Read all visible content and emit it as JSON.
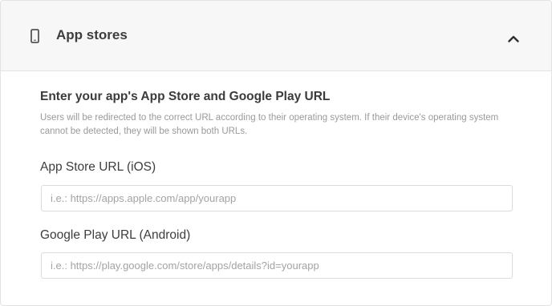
{
  "header": {
    "title": "App stores",
    "icon": "phone-icon",
    "toggle_icon": "chevron-up-icon"
  },
  "section": {
    "title": "Enter your app's App Store and Google Play URL",
    "description": "Users will be redirected to the correct URL according to their operating system. If their device's operating system cannot be detected, they will be shown both URLs."
  },
  "fields": {
    "ios": {
      "label": "App Store URL (iOS)",
      "value": "",
      "placeholder": "i.e.: https://apps.apple.com/app/yourapp"
    },
    "android": {
      "label": "Google Play URL (Android)",
      "value": "",
      "placeholder": "i.e.: https://play.google.com/store/apps/details?id=yourapp"
    }
  },
  "colors": {
    "header_bg": "#f7f7f7",
    "border": "#e3e3e3",
    "title_text": "#3d3d3d",
    "muted_text": "#9a9a9a"
  }
}
